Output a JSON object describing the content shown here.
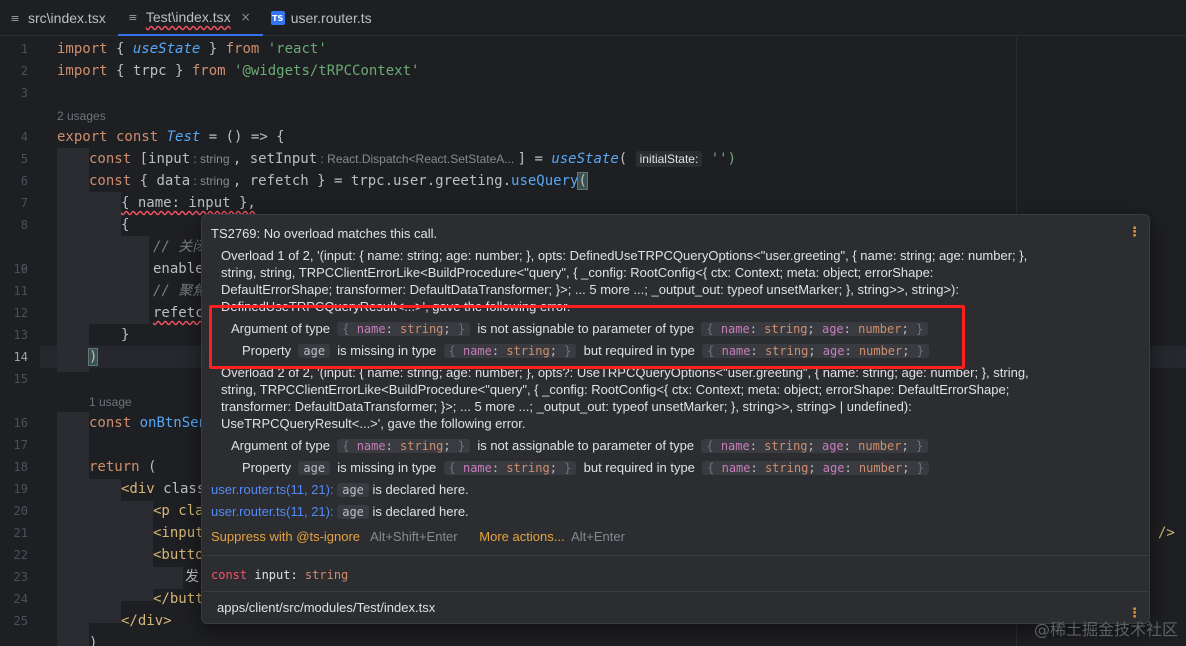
{
  "tabs": [
    {
      "icon": "file-lines-icon",
      "label": "src\\index.tsx",
      "active": false
    },
    {
      "icon": "file-lines-icon",
      "label": "Test\\index.tsx",
      "active": true,
      "close": "×"
    },
    {
      "icon": "typescript-icon",
      "icon_text": "TS",
      "label": "user.router.ts",
      "active": false
    }
  ],
  "gutter": [
    "1",
    "2",
    "3",
    "4",
    "5",
    "6",
    "7",
    "8",
    "9",
    "10",
    "11",
    "12",
    "13",
    "14",
    "15",
    "16",
    "17",
    "18",
    "19",
    "20",
    "21",
    "22",
    "23",
    "24",
    "25"
  ],
  "usage_notes": {
    "two": "2 usages",
    "one": "1 usage"
  },
  "code": {
    "l1": {
      "a": "import",
      "b": " { ",
      "c": "useState",
      "d": " } ",
      "e": "from",
      "f": " 'react'"
    },
    "l2": {
      "a": "import",
      "b": " { trpc } ",
      "c": "from",
      "d": " '@widgets/tRPCContext'"
    },
    "l4": {
      "a": "export",
      "b": " const ",
      "c": "Test",
      "d": " = () => {"
    },
    "l5": {
      "a": "const",
      "b": " [input",
      "h1": " : string ",
      "c": ", setInput",
      "h2": " : React.Dispatch<React.SetStateA... ",
      "d": "] = ",
      "e": "useState",
      "f": "( ",
      "h3": "initialState:",
      "g": " '')"
    },
    "l6": {
      "a": "const",
      "b": " { data",
      "h1": " : string ",
      "c": ", refetch } = trpc.user.greeting.",
      "d": "useQuery",
      "e": "("
    },
    "l7": "{ name: input },",
    "l8": "{",
    "l9": "// 关闭",
    "l10": "enable",
    "l11": "// 聚焦",
    "l12": "refetc",
    "l13": "}",
    "l14": ")",
    "l16": {
      "a": "const",
      "b": " onBtnSen"
    },
    "l18": {
      "a": "return",
      "b": " ("
    },
    "l19": {
      "a": "<div",
      "b": " class"
    },
    "l20": "<p cla",
    "l21": "<input",
    "l21_end": "/>",
    "l22": "<butto",
    "l23": "发",
    "l24": "</butt",
    "l25": "</div>",
    "l26": ")"
  },
  "popup": {
    "title": "TS2769: No overload matches this call.",
    "overload1": [
      "Overload 1 of 2, '(input: { name: string; age: number; }, opts: DefinedUseTRPCQueryOptions<\"user.greeting\", { name: string; age: number; },",
      "string, string, TRPCClientErrorLike<BuildProcedure<\"query\", { _config: RootConfig<{ ctx: Context; meta: object; errorShape:",
      "DefaultErrorShape; transformer: DefaultDataTransformer; }>; ... 5 more ...; _output_out: typeof unsetMarker; }, string>>, string>):",
      "DefinedUseTRPCQueryResult<...>', gave the following error."
    ],
    "arg_prefix": "Argument of type",
    "arg_mid": "is not assignable to parameter of type",
    "prop_prefix": "Property",
    "prop_mid": "is missing in type",
    "prop_suffix": "but required in type",
    "pill_name_only": {
      "k1": "name",
      "t1": "string"
    },
    "pill_name_age": {
      "k1": "name",
      "t1": "string",
      "k2": "age",
      "t2": "number"
    },
    "pill_age": "age",
    "overload2": [
      "Overload 2 of 2, '(input: { name: string; age: number; }, opts?: UseTRPCQueryOptions<\"user.greeting\", { name: string; age: number; }, string,",
      "string, TRPCClientErrorLike<BuildProcedure<\"query\", { _config: RootConfig<{ ctx: Context; meta: object; errorShape: DefaultErrorShape;",
      "transformer: DefaultDataTransformer; }>; ... 5 more ...; _output_out: typeof unsetMarker; }, string>>, string> | undefined):",
      "UseTRPCQueryResult<...>', gave the following error."
    ],
    "declared_link": "user.router.ts(11, 21):",
    "declared_text": "is declared here.",
    "suppress_label": "Suppress with @ts-ignore",
    "suppress_shortcut": "Alt+Shift+Enter",
    "more_actions_label": "More actions...",
    "more_actions_shortcut": "Alt+Enter",
    "decl": {
      "kw": "const",
      "rest": " input: ",
      "type": "string"
    },
    "path": "apps/client/src/modules/Test/index.tsx",
    "kebab": "⋮"
  },
  "watermark": "@稀土掘金技术社区",
  "colors": {
    "accent": "#3574f0",
    "error_box": "#ff1f1f",
    "link": "#e8a33d",
    "keyword": "#cf8e6d",
    "string": "#6aab73",
    "function": "#56a8f5"
  }
}
